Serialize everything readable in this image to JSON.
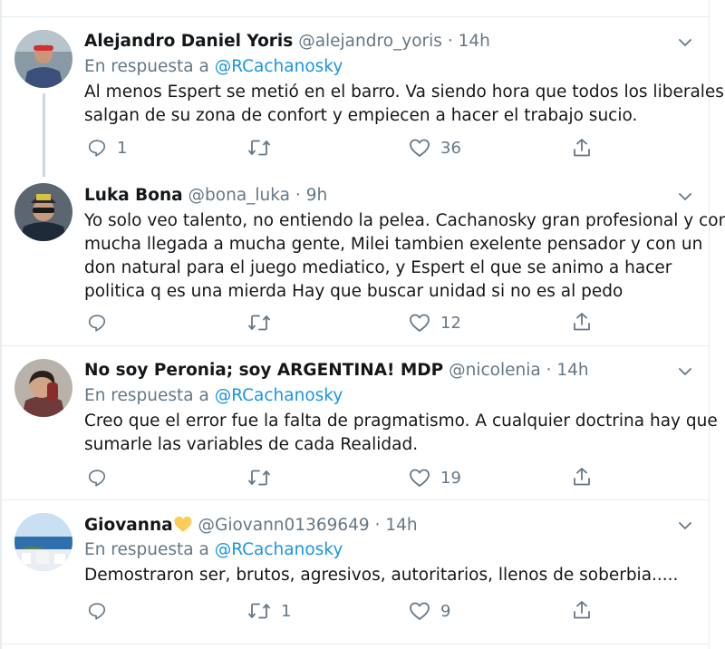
{
  "tweets": [
    {
      "name": "Alejandro Daniel Yoris",
      "handle": "@alejandro_yoris",
      "separator": "·",
      "time": "14h",
      "reply_prefix": "En respuesta a",
      "reply_to": "@RCachanosky",
      "lines": [
        "Al menos Espert se metió en el barro. Va siendo hora que todos los liberales",
        "salgan de su zona de confort y empiecen a hacer el trabajo sucio."
      ],
      "replies": "1",
      "retweets": "",
      "likes": "36"
    },
    {
      "name": "Luka Bona",
      "handle": "@bona_luka",
      "separator": "·",
      "time": "9h",
      "lines": [
        "Yo solo veo talento, no entiendo la pelea. Cachanosky gran profesional y con",
        "mucha llegada a mucha gente, Milei tambien exelente pensador y con un",
        "don natural para el juego mediatico, y Espert el que se animo a hacer",
        "politica q es una mierda Hay que buscar unidad si no es al pedo"
      ],
      "replies": "",
      "retweets": "",
      "likes": "12"
    },
    {
      "name": "No soy Peronia; soy ARGENTINA! MDP",
      "handle": "@nicolenia",
      "separator": "·",
      "time": "14h",
      "reply_prefix": "En respuesta a",
      "reply_to": "@RCachanosky",
      "lines": [
        "Creo que el error fue la falta de pragmatismo. A cualquier doctrina hay que",
        "sumarle las variables de cada Realidad."
      ],
      "replies": "",
      "retweets": "",
      "likes": "19"
    },
    {
      "name": "Giovanna",
      "handle": "@Giovann01369649",
      "separator": "·",
      "time": "14h",
      "reply_prefix": "En respuesta a",
      "reply_to": "@RCachanosky",
      "lines": [
        "Demostraron ser, brutos, agresivos, autoritarios, llenos de soberbia....."
      ],
      "replies": "",
      "retweets": "1",
      "likes": "9"
    }
  ],
  "icons": {
    "reply": "reply-icon",
    "retweet": "retweet-icon",
    "like": "heart-icon",
    "share": "share-icon",
    "more": "chevron-down-icon",
    "name_emoji": "yellow-heart-emoji"
  },
  "colors": {
    "text": "#14171a",
    "secondary": "#657786",
    "link": "#1b95e0",
    "border": "#e6ecf0",
    "thread_line": "#ccd6dd"
  }
}
